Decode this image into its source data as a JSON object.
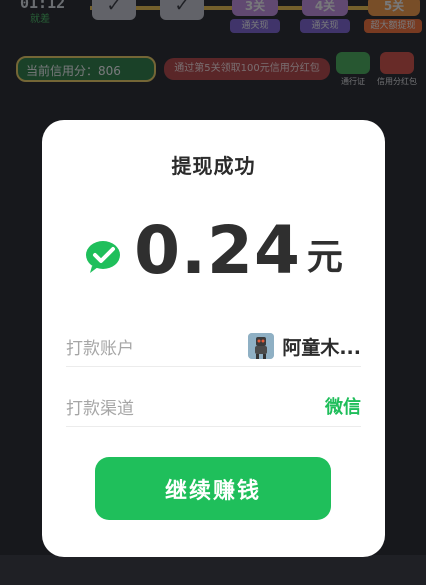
{
  "background": {
    "timer": "01:12",
    "timer_sub": "就差",
    "checks": [
      "✓",
      "✓"
    ],
    "stages": [
      {
        "label": "3关",
        "tag": "通关现"
      },
      {
        "label": "4关",
        "tag": "通关现"
      },
      {
        "label": "5关",
        "tag": "超大额提现"
      }
    ],
    "credit_label": "当前信用分：806",
    "task_text": "通过第5关领取100元信用分红包",
    "right_icons": [
      "通行证",
      "信用分红包"
    ]
  },
  "modal": {
    "title": "提现成功",
    "amount": "0.24",
    "currency": "元",
    "rows": [
      {
        "label": "打款账户",
        "value": "阿童木..."
      },
      {
        "label": "打款渠道",
        "value": "微信"
      }
    ],
    "button_label": "继续赚钱"
  },
  "colors": {
    "accent_green": "#1fbf5b",
    "wechat_green": "#1fbe5a"
  }
}
